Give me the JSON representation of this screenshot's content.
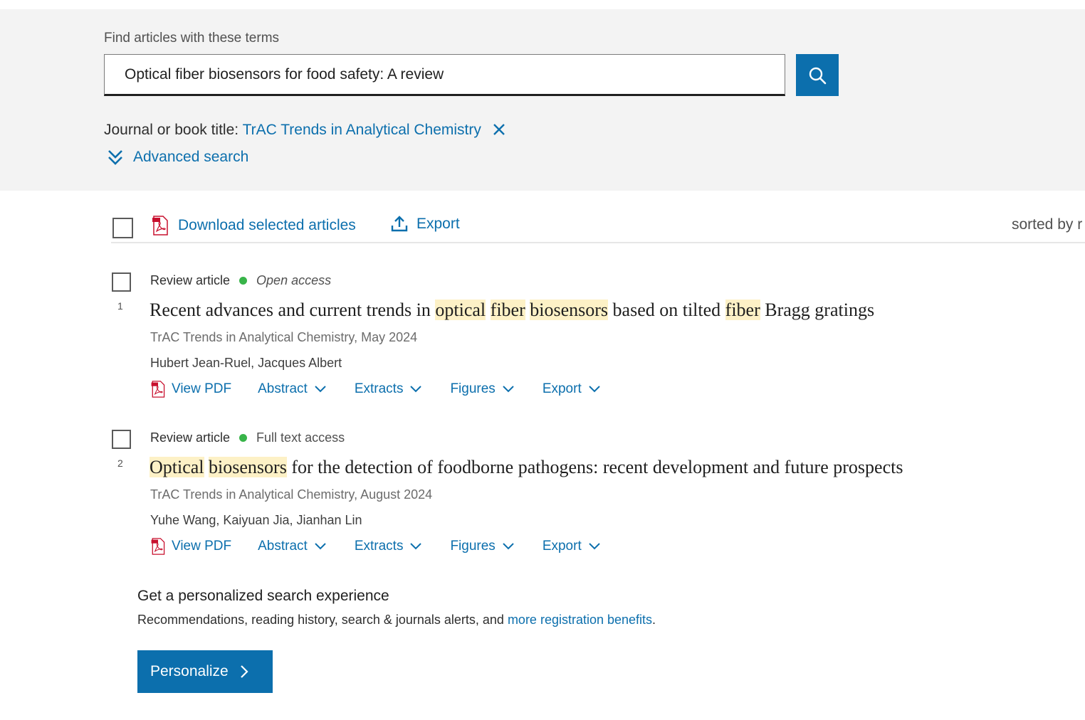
{
  "search": {
    "find_label": "Find articles with these terms",
    "query": "Optical fiber biosensors for food safety: A review",
    "journal_label": "Journal or book title: ",
    "journal_value": "TrAC Trends in Analytical Chemistry",
    "advanced_label": "Advanced search"
  },
  "toolbar": {
    "download_label": "Download selected articles",
    "export_label": "Export",
    "sorted_label": "sorted by r"
  },
  "results": [
    {
      "number": "1",
      "type": "Review article",
      "access": "Open access",
      "title_parts": [
        "Recent advances and current trends in ",
        "optical",
        " ",
        "fiber",
        " ",
        "biosensors",
        " based on tilted ",
        "fiber",
        " Bragg gratings"
      ],
      "source": "TrAC Trends in Analytical Chemistry, May 2024",
      "authors": "Hubert Jean-Ruel, Jacques Albert",
      "actions": {
        "view_pdf": "View PDF",
        "abstract": "Abstract",
        "extracts": "Extracts",
        "figures": "Figures",
        "export": "Export"
      }
    },
    {
      "number": "2",
      "type": "Review article",
      "access": "Full text access",
      "title_parts": [
        "Optical",
        " ",
        "biosensors",
        " for the detection of foodborne pathogens: recent development and future prospects"
      ],
      "source": "TrAC Trends in Analytical Chemistry, August 2024",
      "authors": "Yuhe Wang, Kaiyuan Jia, Jianhan Lin",
      "actions": {
        "view_pdf": "View PDF",
        "abstract": "Abstract",
        "extracts": "Extracts",
        "figures": "Figures",
        "export": "Export"
      }
    }
  ],
  "promo": {
    "title": "Get a personalized search experience",
    "text": "Recommendations, reading history, search & journals alerts, and ",
    "link": "more registration benefits",
    "suffix": ".",
    "button": "Personalize"
  },
  "colors": {
    "accent": "#0c6fad",
    "highlight": "#fdf1c6",
    "access_dot": "#38b449",
    "panel_bg": "#f3f3f3"
  }
}
